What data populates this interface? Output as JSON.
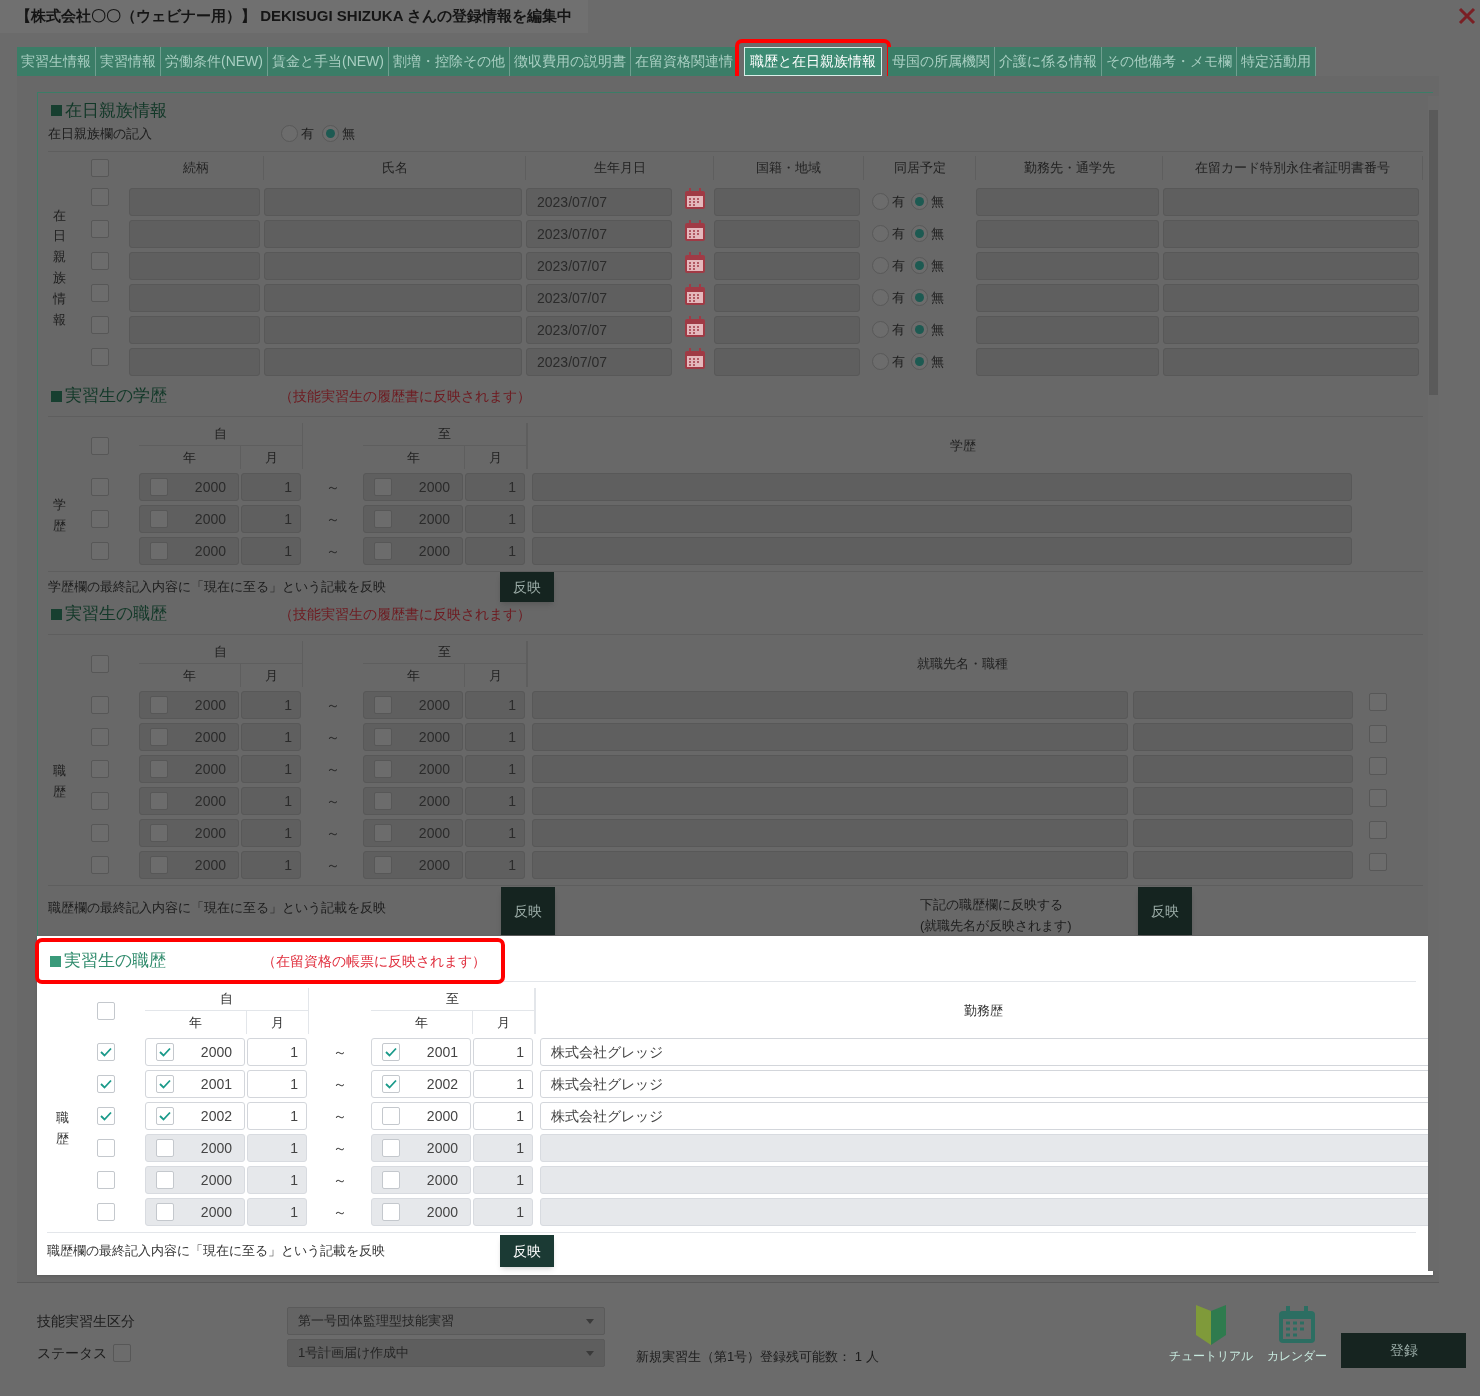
{
  "window": {
    "title": "【株式会社〇〇（ウェビナー用）】 DEKISUGI SHIZUKA さんの登録情報を編集中"
  },
  "tabs": [
    {
      "label": "実習生情報",
      "selected": false,
      "highlighted": false
    },
    {
      "label": "実習情報",
      "selected": false,
      "highlighted": false
    },
    {
      "label": "労働条件(NEW)",
      "selected": false,
      "highlighted": false
    },
    {
      "label": "賃金と手当(NEW)",
      "selected": false,
      "highlighted": false
    },
    {
      "label": "割増・控除その他",
      "selected": false,
      "highlighted": false
    },
    {
      "label": "徴収費用の説明書",
      "selected": false,
      "highlighted": false
    },
    {
      "label": "在留資格関連情",
      "selected": false,
      "highlighted": false
    },
    {
      "label": "職歴と在日親族情報",
      "selected": true,
      "highlighted": true
    },
    {
      "label": "母国の所属機関",
      "selected": false,
      "highlighted": false
    },
    {
      "label": "介護に係る情報",
      "selected": false,
      "highlighted": false
    },
    {
      "label": "その他備考・メモ欄",
      "selected": false,
      "highlighted": false
    },
    {
      "label": "特定活動用",
      "selected": false,
      "highlighted": false
    }
  ],
  "family": {
    "heading": "在日親族情報",
    "entry_label": "在日親族欄の記入",
    "entry_options": [
      {
        "label": "有",
        "selected": false
      },
      {
        "label": "無",
        "selected": true
      }
    ],
    "header_checked": false,
    "columns": [
      "続柄",
      "氏名",
      "生年月日",
      "国籍・地域",
      "同居予定",
      "勤務先・通学先",
      "在留カード特別永住者証明書番号"
    ],
    "side_label": "在日親族情報",
    "rows": [
      {
        "checked": false,
        "birth_date": "2023/07/07",
        "cohabit": [
          {
            "label": "有",
            "selected": false
          },
          {
            "label": "無",
            "selected": true
          }
        ]
      },
      {
        "checked": false,
        "birth_date": "2023/07/07",
        "cohabit": [
          {
            "label": "有",
            "selected": false
          },
          {
            "label": "無",
            "selected": true
          }
        ]
      },
      {
        "checked": false,
        "birth_date": "2023/07/07",
        "cohabit": [
          {
            "label": "有",
            "selected": false
          },
          {
            "label": "無",
            "selected": true
          }
        ]
      },
      {
        "checked": false,
        "birth_date": "2023/07/07",
        "cohabit": [
          {
            "label": "有",
            "selected": false
          },
          {
            "label": "無",
            "selected": true
          }
        ]
      },
      {
        "checked": false,
        "birth_date": "2023/07/07",
        "cohabit": [
          {
            "label": "有",
            "selected": false
          },
          {
            "label": "無",
            "selected": true
          }
        ]
      },
      {
        "checked": false,
        "birth_date": "2023/07/07",
        "cohabit": [
          {
            "label": "有",
            "selected": false
          },
          {
            "label": "無",
            "selected": true
          }
        ]
      }
    ]
  },
  "education": {
    "heading": "実習生の学歴",
    "note": "（技能実習生の履歴書に反映されます）",
    "header_checked": false,
    "from_label": "自",
    "from_year_label": "年",
    "from_month_label": "月",
    "to_label": "至",
    "to_year_label": "年",
    "to_month_label": "月",
    "content_label": "学歴",
    "side_label": "学歴",
    "rows": [
      {
        "checked": false,
        "from_year_checked": false,
        "from_year": "2000",
        "from_month": "1",
        "sep": "～",
        "to_year_checked": false,
        "to_year": "2000",
        "to_month": "1"
      },
      {
        "checked": false,
        "from_year_checked": false,
        "from_year": "2000",
        "from_month": "1",
        "sep": "～",
        "to_year_checked": false,
        "to_year": "2000",
        "to_month": "1"
      },
      {
        "checked": false,
        "from_year_checked": false,
        "from_year": "2000",
        "from_month": "1",
        "sep": "～",
        "to_year_checked": false,
        "to_year": "2000",
        "to_month": "1"
      }
    ],
    "reflect_text": "学歴欄の最終記入内容に「現在に至る」という記載を反映",
    "reflect_button": "反映"
  },
  "career_resume": {
    "heading": "実習生の職歴",
    "note": "（技能実習生の履歴書に反映されます）",
    "header_checked": false,
    "from_label": "自",
    "from_year_label": "年",
    "from_month_label": "月",
    "to_label": "至",
    "to_year_label": "年",
    "to_month_label": "月",
    "content_label": "就職先名・職種",
    "side_label": "職歴",
    "rows": [
      {
        "checked": false,
        "from_year_checked": false,
        "from_year": "2000",
        "from_month": "1",
        "sep": "～",
        "to_year_checked": false,
        "to_year": "2000",
        "to_month": "1",
        "extra_checked": false
      },
      {
        "checked": false,
        "from_year_checked": false,
        "from_year": "2000",
        "from_month": "1",
        "sep": "～",
        "to_year_checked": false,
        "to_year": "2000",
        "to_month": "1",
        "extra_checked": false
      },
      {
        "checked": false,
        "from_year_checked": false,
        "from_year": "2000",
        "from_month": "1",
        "sep": "～",
        "to_year_checked": false,
        "to_year": "2000",
        "to_month": "1",
        "extra_checked": false
      },
      {
        "checked": false,
        "from_year_checked": false,
        "from_year": "2000",
        "from_month": "1",
        "sep": "～",
        "to_year_checked": false,
        "to_year": "2000",
        "to_month": "1",
        "extra_checked": false
      },
      {
        "checked": false,
        "from_year_checked": false,
        "from_year": "2000",
        "from_month": "1",
        "sep": "～",
        "to_year_checked": false,
        "to_year": "2000",
        "to_month": "1",
        "extra_checked": false
      },
      {
        "checked": false,
        "from_year_checked": false,
        "from_year": "2000",
        "from_month": "1",
        "sep": "～",
        "to_year_checked": false,
        "to_year": "2000",
        "to_month": "1",
        "extra_checked": false
      }
    ],
    "reflect_text": "職歴欄の最終記入内容に「現在に至る」という記載を反映",
    "reflect_button": "反映",
    "copy_text": "下記の職歴欄に反映する\n(就職先名が反映されます)",
    "copy_button": "反映"
  },
  "career_status": {
    "highlighted": true,
    "heading": "実習生の職歴",
    "note": "（在留資格の帳票に反映されます）",
    "header_checked": false,
    "from_label": "自",
    "from_year_label": "年",
    "from_month_label": "月",
    "to_label": "至",
    "to_year_label": "年",
    "to_month_label": "月",
    "content_label": "勤務歴",
    "side_label": "職歴",
    "rows": [
      {
        "checked": true,
        "from_year_checked": true,
        "from_year": "2000",
        "from_month": "1",
        "sep": "～",
        "to_year_checked": true,
        "to_year": "2001",
        "to_month": "1",
        "text": "株式会社グレッジ"
      },
      {
        "checked": true,
        "from_year_checked": true,
        "from_year": "2001",
        "from_month": "1",
        "sep": "～",
        "to_year_checked": true,
        "to_year": "2002",
        "to_month": "1",
        "text": "株式会社グレッジ"
      },
      {
        "checked": true,
        "from_year_checked": true,
        "from_year": "2002",
        "from_month": "1",
        "sep": "～",
        "to_year_checked": false,
        "to_year": "2000",
        "to_month": "1",
        "text": "株式会社グレッジ"
      },
      {
        "checked": false,
        "from_year_checked": false,
        "from_year": "2000",
        "from_month": "1",
        "sep": "～",
        "to_year_checked": false,
        "to_year": "2000",
        "to_month": "1"
      },
      {
        "checked": false,
        "from_year_checked": false,
        "from_year": "2000",
        "from_month": "1",
        "sep": "～",
        "to_year_checked": false,
        "to_year": "2000",
        "to_month": "1"
      },
      {
        "checked": false,
        "from_year_checked": false,
        "from_year": "2000",
        "from_month": "1",
        "sep": "～",
        "to_year_checked": false,
        "to_year": "2000",
        "to_month": "1"
      }
    ],
    "reflect_text": "職歴欄の最終記入内容に「現在に至る」という記載を反映",
    "reflect_button": "反映"
  },
  "footer": {
    "trainee_type_label": "技能実習生区分",
    "trainee_type": "第一号団体監理型技能実習",
    "status_label": "ステータス",
    "status_checked": false,
    "status": "1号計画届け作成中",
    "remaining": "新規実習生（第1号）登録残可能数： 1 人",
    "tools": [
      {
        "kind": "tutorial",
        "label": "チュートリアル"
      },
      {
        "kind": "calendar",
        "label": "カレンダー"
      }
    ],
    "register_button": "登録"
  }
}
